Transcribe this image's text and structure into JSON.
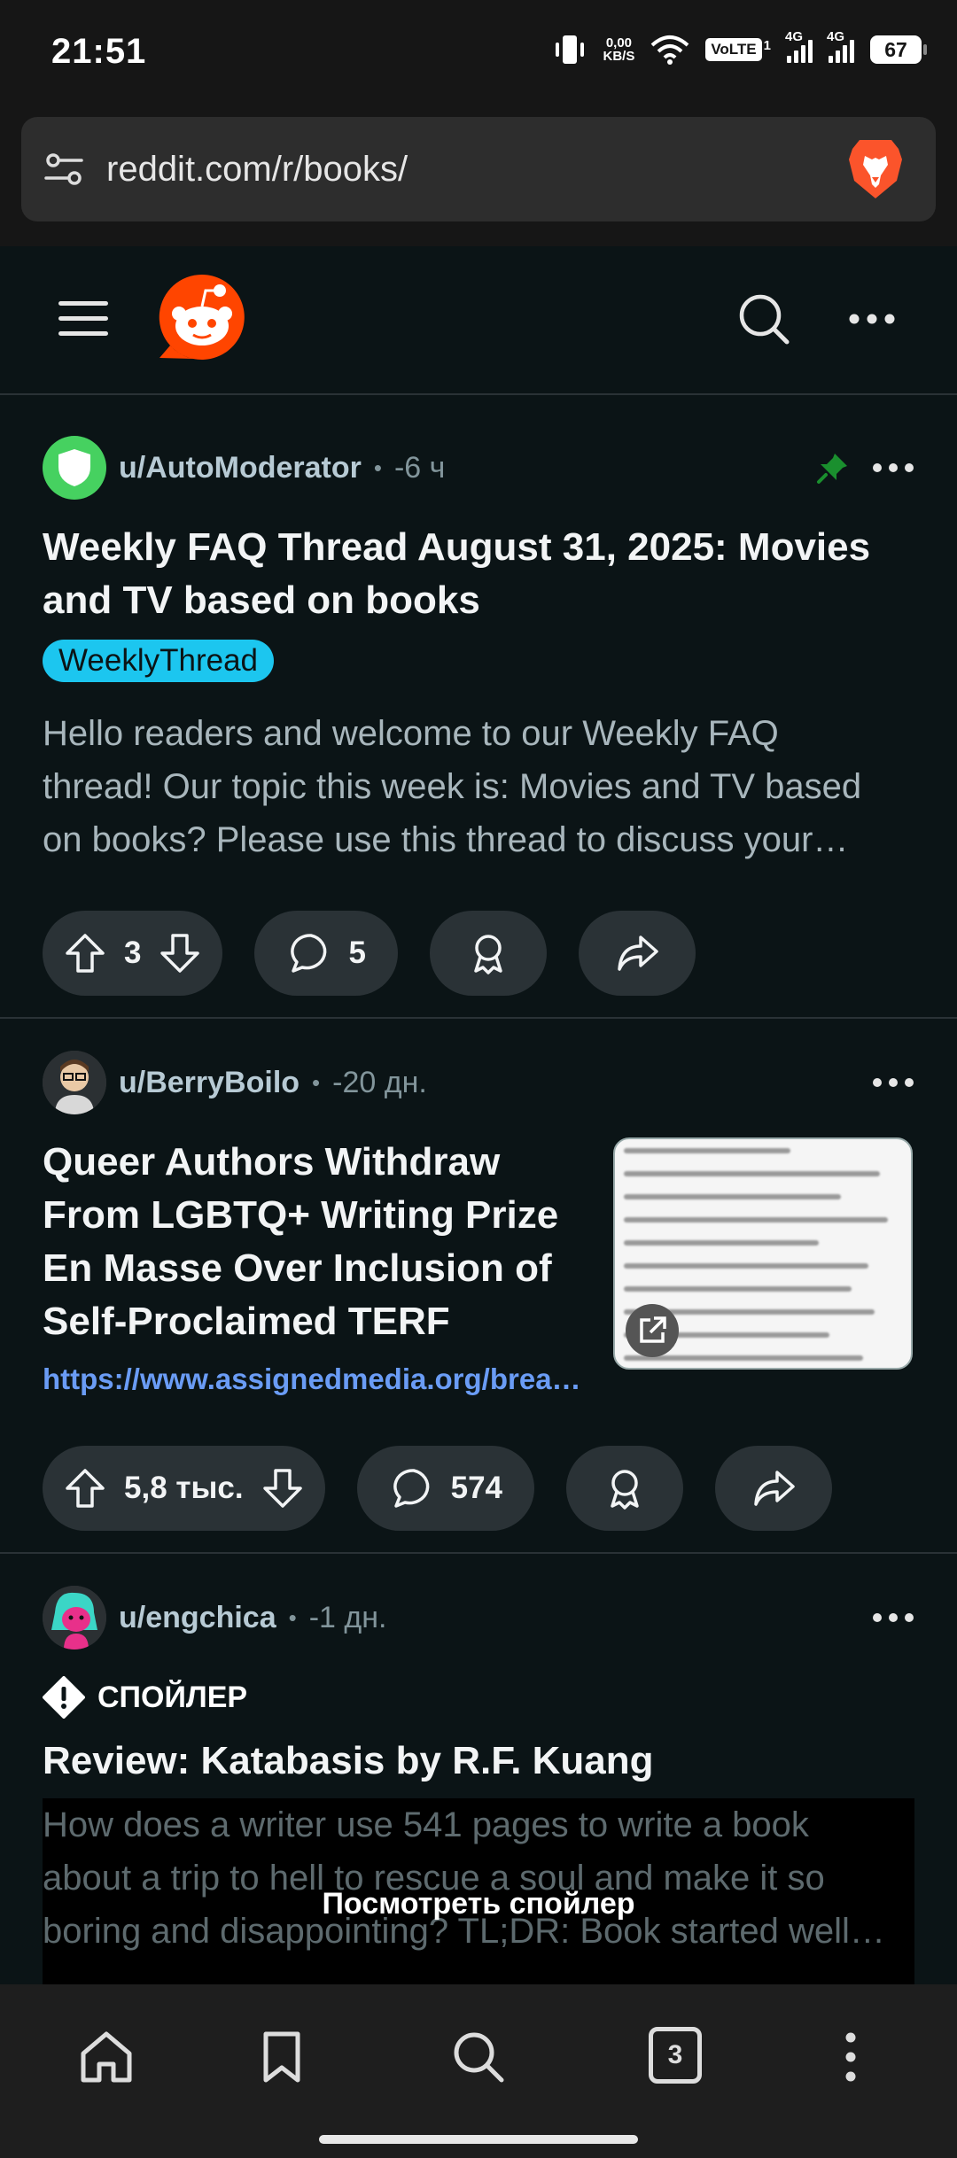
{
  "status_bar": {
    "time": "21:51",
    "net_speed_value": "0,00",
    "net_speed_unit": "KB/S",
    "volte": "VoLTE",
    "volte_sim": "1",
    "signal1_label": "4G",
    "signal2_label": "4G",
    "battery": "67"
  },
  "browser": {
    "url": "reddit.com/r/books/",
    "icons": [
      "tune-icon",
      "brave-lion-icon"
    ]
  },
  "reddit_header": {
    "icons": [
      "hamburger-menu-icon",
      "reddit-logo",
      "search-icon",
      "more-icon"
    ]
  },
  "posts": [
    {
      "author": "u/AutoModerator",
      "time": "-6 ч",
      "pinned": true,
      "title_line1": "Weekly FAQ Thread August 31, 2025: Movies",
      "title_line2": "and TV based on books",
      "flair": "WeeklyThread",
      "body_line1": "Hello readers and welcome to our Weekly FAQ",
      "body_line2": "thread! Our topic this week is: Movies and TV based",
      "body_line3": "on books? Please use this thread to discuss your…",
      "votes": "3",
      "comments": "5"
    },
    {
      "author": "u/BerryBoilo",
      "time": "-20 дн.",
      "title_line1": "Queer Authors Withdraw",
      "title_line2": "From LGBTQ+ Writing Prize",
      "title_line3": "En Masse Over Inclusion of",
      "title_line4": "Self-Proclaimed TERF",
      "link": "https://www.assignedmedia.org/brea…",
      "votes": "5,8 тыс.",
      "comments": "574"
    },
    {
      "author": "u/engchica",
      "time": "-1 дн.",
      "spoiler_label": "СПОЙЛЕР",
      "title_line1": "Review: Katabasis by R.F. Kuang",
      "body_line1": "How does a writer use 541 pages to write a book",
      "body_line2": "about a trip to hell to rescue a soul and make it so",
      "body_line3": "boring and disappointing? TL;DR: Book started well…",
      "reveal_label": "Посмотреть спойлер"
    }
  ],
  "bottom_nav": {
    "tabs_count": "3",
    "icons": [
      "home-icon",
      "bookmark-icon",
      "search-icon",
      "tabs-icon",
      "menu-dots-icon"
    ]
  },
  "colors": {
    "background": "#0b1416",
    "pill": "#2a3236",
    "flair": "#1cc6ef",
    "link": "#6a9cf5",
    "reddit_orange": "#ff4500",
    "pin_green": "#1a8f2e"
  }
}
